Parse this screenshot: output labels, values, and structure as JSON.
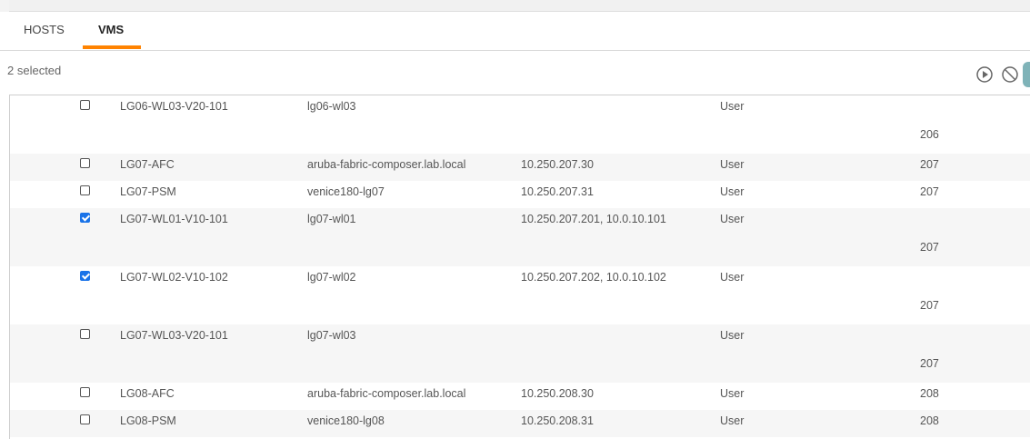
{
  "tabs": [
    {
      "label": "HOSTS",
      "active": false
    },
    {
      "label": "VMS",
      "active": true
    }
  ],
  "accent_color": "#ff8300",
  "checkbox_color": "#1a73e8",
  "selection": {
    "count_text": "2 selected"
  },
  "toolbar": {
    "icons": [
      "play-circle-icon",
      "disable-icon"
    ]
  },
  "rows": [
    {
      "checked": false,
      "name": "LG06-WL03-V20-101",
      "host": "lg06-wl03",
      "ip": "",
      "role": "User",
      "num": "206",
      "tall": true
    },
    {
      "checked": false,
      "name": "LG07-AFC",
      "host": "aruba-fabric-composer.lab.local",
      "ip": "10.250.207.30",
      "role": "User",
      "num": "207",
      "tall": false
    },
    {
      "checked": false,
      "name": "LG07-PSM",
      "host": "venice180-lg07",
      "ip": "10.250.207.31",
      "role": "User",
      "num": "207",
      "tall": false
    },
    {
      "checked": true,
      "name": "LG07-WL01-V10-101",
      "host": "lg07-wl01",
      "ip": "10.250.207.201, 10.0.10.101",
      "role": "User",
      "num": "207",
      "tall": true
    },
    {
      "checked": true,
      "name": "LG07-WL02-V10-102",
      "host": "lg07-wl02",
      "ip": "10.250.207.202, 10.0.10.102",
      "role": "User",
      "num": "207",
      "tall": true
    },
    {
      "checked": false,
      "name": "LG07-WL03-V20-101",
      "host": "lg07-wl03",
      "ip": "",
      "role": "User",
      "num": "207",
      "tall": true
    },
    {
      "checked": false,
      "name": "LG08-AFC",
      "host": "aruba-fabric-composer.lab.local",
      "ip": "10.250.208.30",
      "role": "User",
      "num": "208",
      "tall": false
    },
    {
      "checked": false,
      "name": "LG08-PSM",
      "host": "venice180-lg08",
      "ip": "10.250.208.31",
      "role": "User",
      "num": "208",
      "tall": false
    }
  ]
}
